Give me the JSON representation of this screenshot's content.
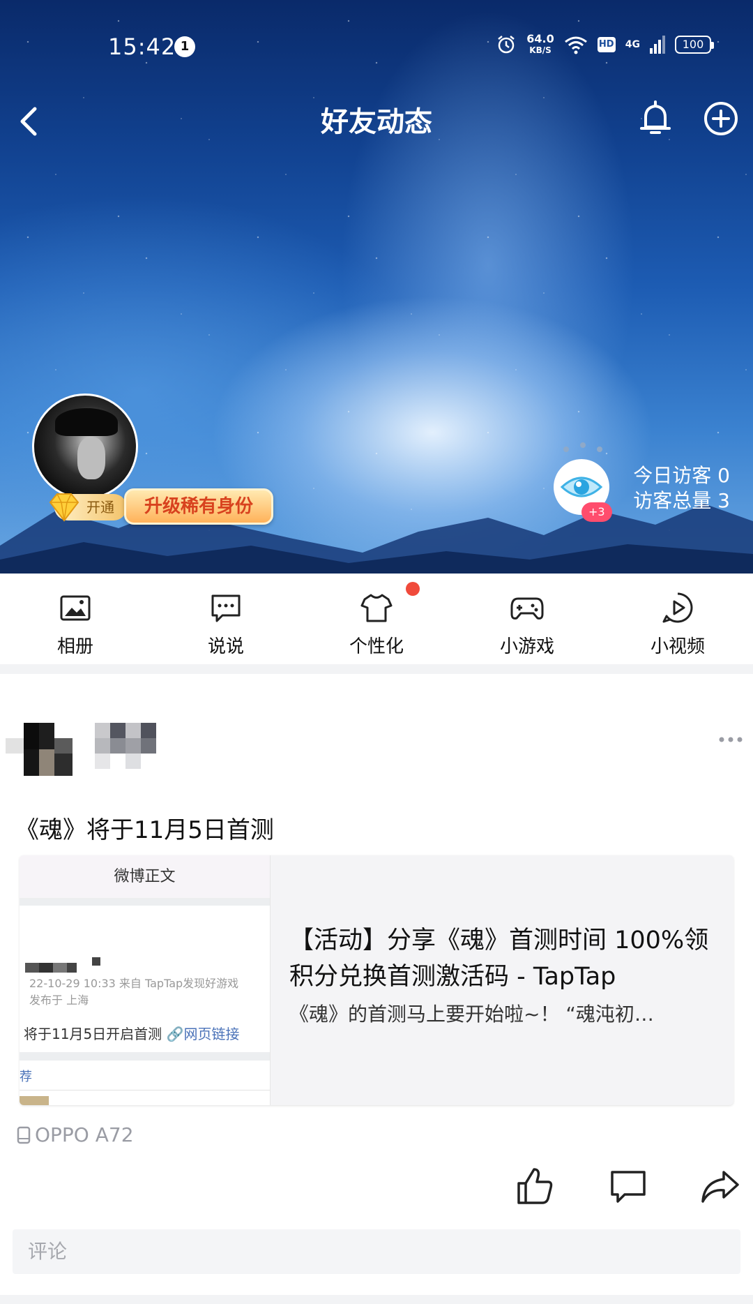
{
  "status_bar": {
    "time": "15:42",
    "notification_count": "1",
    "speed_value": "64.0",
    "speed_unit": "KB/S",
    "hd": "HD",
    "network": "4G",
    "battery": "100"
  },
  "nav": {
    "title": "好友动态",
    "back_icon": "back-arrow-icon",
    "bell_icon": "bell-icon",
    "add_icon": "plus-circle-icon"
  },
  "profile": {
    "vip_open_label": "开通",
    "vip_upgrade_label": "升级稀有身份",
    "visitor_badge": "+3",
    "visitors_today": "今日访客 0",
    "visitors_total": "访客总量 3"
  },
  "toolbar": {
    "items": [
      {
        "label": "相册",
        "icon": "album-icon"
      },
      {
        "label": "说说",
        "icon": "chat-bubble-icon"
      },
      {
        "label": "个性化",
        "icon": "tshirt-icon"
      },
      {
        "label": "小游戏",
        "icon": "gamepad-icon"
      },
      {
        "label": "小视频",
        "icon": "video-play-icon"
      }
    ]
  },
  "post": {
    "title": "《魂》将于11月5日首测",
    "share_card": {
      "thumb_header": "微博正文",
      "thumb_meta_1": "22-10-29 10:33  来自 TapTap发现好游戏",
      "thumb_meta_2": "发布于 上海",
      "thumb_body": "将于11月5日开启首测",
      "thumb_link": "🔗网页链接",
      "thumb_recommend": "荐",
      "title": "【活动】分享《魂》首测时间 100%领积分兑换首测激活码 - TapTap",
      "description": "《魂》的首测马上要开始啦~！ “魂沌初…"
    },
    "device": "OPPO A72",
    "comment_placeholder": "评论"
  },
  "colors": {
    "accent_red": "#f04a3b",
    "vip_text": "#d8421e",
    "link_blue": "#4a72b8",
    "muted_gray": "#9a9ca4"
  }
}
